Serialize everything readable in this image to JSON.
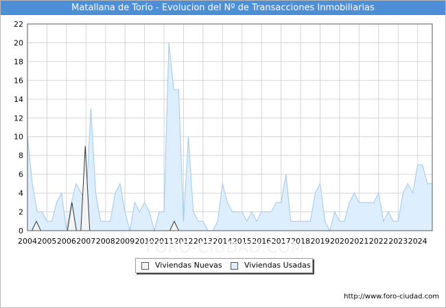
{
  "header": {
    "title": "Matallana de Torío - Evolucion del Nº de Transacciones Inmobiliarias"
  },
  "footer": {
    "source": "http://www.foro-ciudad.com",
    "watermark": "FORO-CIUDAD.COM"
  },
  "legend": {
    "items": [
      {
        "label": "Viviendas Nuevas",
        "color": "#f4f4f4"
      },
      {
        "label": "Viviendas Usadas",
        "color": "#ddeeff"
      }
    ]
  },
  "chart_data": {
    "type": "area",
    "title": "Matallana de Torío - Evolucion del Nº de Transacciones Inmobiliarias",
    "x_ticks": [
      "2004",
      "2005",
      "2006",
      "2007",
      "2008",
      "2009",
      "2010",
      "2011",
      "2012",
      "2013",
      "2014",
      "2015",
      "2016",
      "2017",
      "2018",
      "2019",
      "2020",
      "2021",
      "2022",
      "2023",
      "2024"
    ],
    "y_ticks": [
      0,
      2,
      4,
      6,
      8,
      10,
      12,
      14,
      16,
      18,
      20,
      22
    ],
    "ylim": [
      0,
      22
    ],
    "xlim": [
      2004,
      2024.75
    ],
    "grid": true,
    "legend_position": "bottom",
    "series": [
      {
        "name": "Viviendas Nuevas",
        "color": "#f4f4f4",
        "stroke": "#333333",
        "values": [
          0,
          0,
          1,
          0,
          0,
          0,
          0,
          0,
          0,
          0,
          3,
          0,
          0,
          9,
          0,
          0,
          0,
          0,
          0,
          0,
          0,
          0,
          0,
          0,
          0,
          0,
          0,
          0,
          0,
          0,
          0,
          0,
          0,
          1,
          0,
          0,
          0,
          0,
          0,
          0,
          0,
          0,
          0,
          0,
          0,
          0,
          0,
          0,
          0,
          0,
          0,
          0,
          0,
          0,
          0,
          0,
          0,
          0,
          0,
          0,
          0,
          0,
          0,
          0,
          0,
          0,
          0,
          0,
          0,
          0,
          0,
          0,
          0,
          0,
          0,
          0,
          0,
          0,
          0,
          0,
          0,
          0,
          0,
          0,
          0,
          0,
          0,
          0,
          0,
          0,
          0,
          0
        ]
      },
      {
        "name": "Viviendas Usadas",
        "color": "#ddeeff",
        "stroke": "#9cc8ee",
        "values": [
          10,
          5,
          2,
          2,
          1,
          1,
          3,
          4,
          0,
          3,
          5,
          4,
          3,
          13,
          4,
          1,
          1,
          1,
          4,
          5,
          2,
          0,
          3,
          2,
          3,
          2,
          0,
          2,
          2,
          20,
          15,
          15,
          1,
          10,
          2,
          1,
          1,
          0,
          0,
          1,
          5,
          3,
          2,
          2,
          2,
          1,
          2,
          1,
          2,
          2,
          2,
          3,
          3,
          6,
          1,
          1,
          1,
          1,
          1,
          4,
          5,
          1,
          0,
          2,
          1,
          1,
          3,
          4,
          3,
          3,
          3,
          3,
          4,
          1,
          2,
          1,
          1,
          4,
          5,
          4,
          7,
          7,
          5,
          5
        ]
      }
    ]
  }
}
